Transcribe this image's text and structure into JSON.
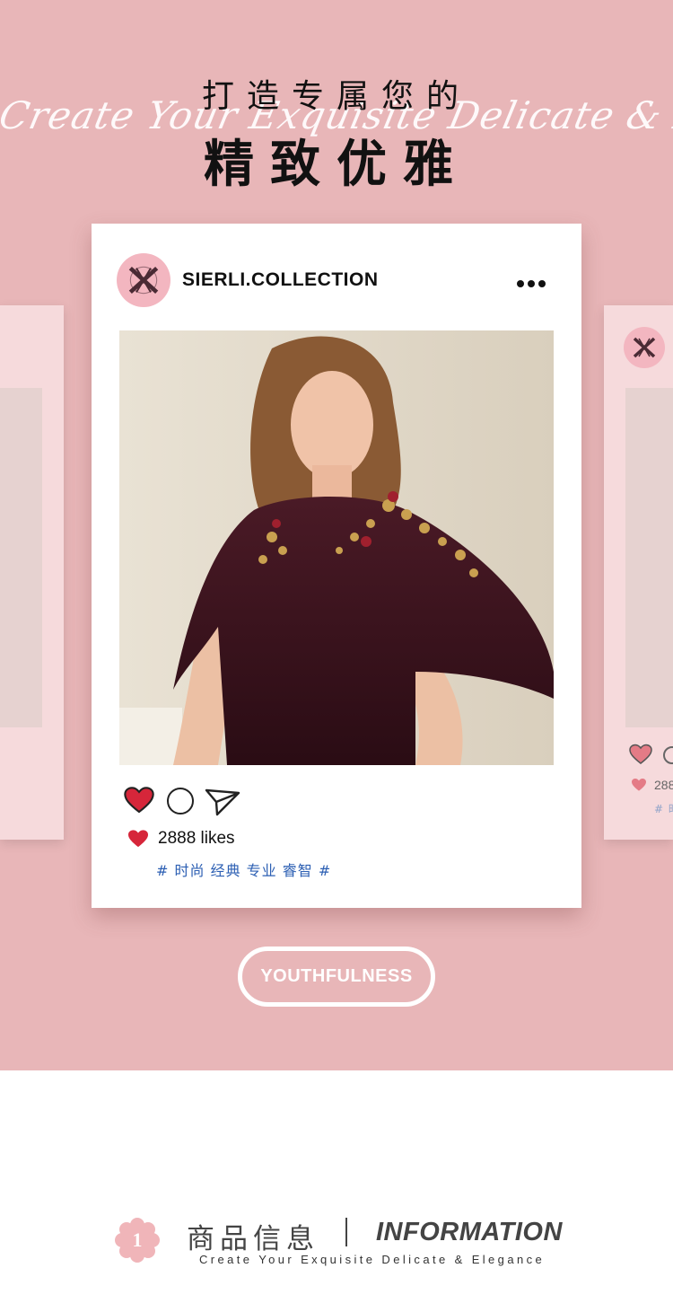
{
  "header": {
    "title_line1": "打造专属您的",
    "title_line2": "精致优雅",
    "script_text": "Create Your Exquisite Delicate & Elegance"
  },
  "post": {
    "account": "SIERLI.COLLECTION",
    "avatar_icon": "sierli-monogram-logo",
    "more_icon": "more-dots-icon",
    "photo_alt": "Model wearing burgundy velvet dress with gold beaded floral embroidery",
    "likes_text": "2888 likes",
    "tags_text": "# 时尚 经典 专业 睿智 #"
  },
  "side_card_right": {
    "likes_partial": "288",
    "tags_partial": "# 时"
  },
  "button": {
    "label": "YOUTHFULNESS"
  },
  "info": {
    "badge_number": "1",
    "title_cn": "商品信息",
    "title_en": "INFORMATION",
    "subtitle": "Create Your Exquisite Delicate & Elegance"
  },
  "colors": {
    "hero_bg": "#e8b6b8",
    "side_card_bg": "#f6dadc",
    "avatar_bg": "#f3b6c0",
    "heart_red": "#d6263a",
    "tag_blue": "#2c5fb3"
  }
}
